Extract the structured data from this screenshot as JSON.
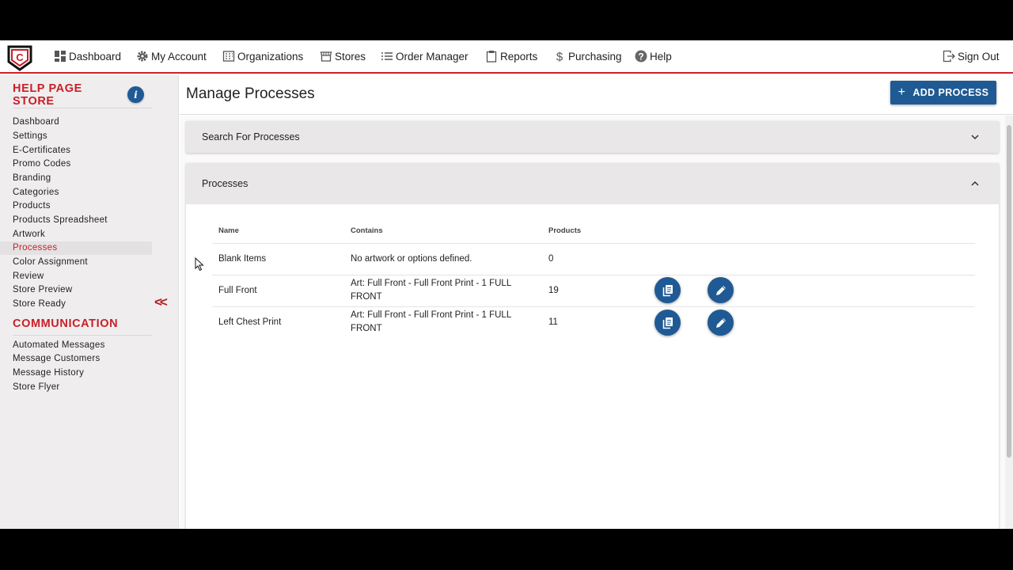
{
  "nav": {
    "items": [
      {
        "label": "Dashboard",
        "icon": "dashboard-icon"
      },
      {
        "label": "My Account",
        "icon": "gear-icon"
      },
      {
        "label": "Organizations",
        "icon": "building-icon"
      },
      {
        "label": "Stores",
        "icon": "store-icon"
      },
      {
        "label": "Order Manager",
        "icon": "list-icon"
      },
      {
        "label": "Reports",
        "icon": "clipboard-icon"
      },
      {
        "label": "Purchasing",
        "icon": "dollar-icon"
      },
      {
        "label": "Help",
        "icon": "help-icon"
      }
    ],
    "sign_out": "Sign Out"
  },
  "sidebar": {
    "store_title": "HELP PAGE STORE",
    "info": "i",
    "items": [
      "Dashboard",
      "Settings",
      "E-Certificates",
      "Promo Codes",
      "Branding",
      "Categories",
      "Products",
      "Products Spreadsheet",
      "Artwork",
      "Processes",
      "Color Assignment",
      "Review",
      "Store Preview",
      "Store Ready"
    ],
    "active": "Processes",
    "collapse": "<<",
    "communication_title": "COMMUNICATION",
    "communication_items": [
      "Automated Messages",
      "Message Customers",
      "Message History",
      "Store Flyer"
    ]
  },
  "main": {
    "title": "Manage Processes",
    "add_button": "ADD PROCESS",
    "search_panel": "Search For Processes",
    "processes_panel": "Processes",
    "columns": [
      "Name",
      "Contains",
      "Products"
    ],
    "rows": [
      {
        "name": "Blank Items",
        "contains": "No artwork or options defined.",
        "products": "0",
        "actions": false
      },
      {
        "name": "Full Front",
        "contains": "Art: Full Front - Full Front Print - 1 FULL FRONT",
        "products": "19",
        "actions": true
      },
      {
        "name": "Left Chest Print",
        "contains": "Art: Full Front - Full Front Print - 1 FULL FRONT",
        "products": "11",
        "actions": true
      }
    ]
  },
  "colors": {
    "brand_red": "#c81f26",
    "accent_blue": "#1f5a94"
  }
}
